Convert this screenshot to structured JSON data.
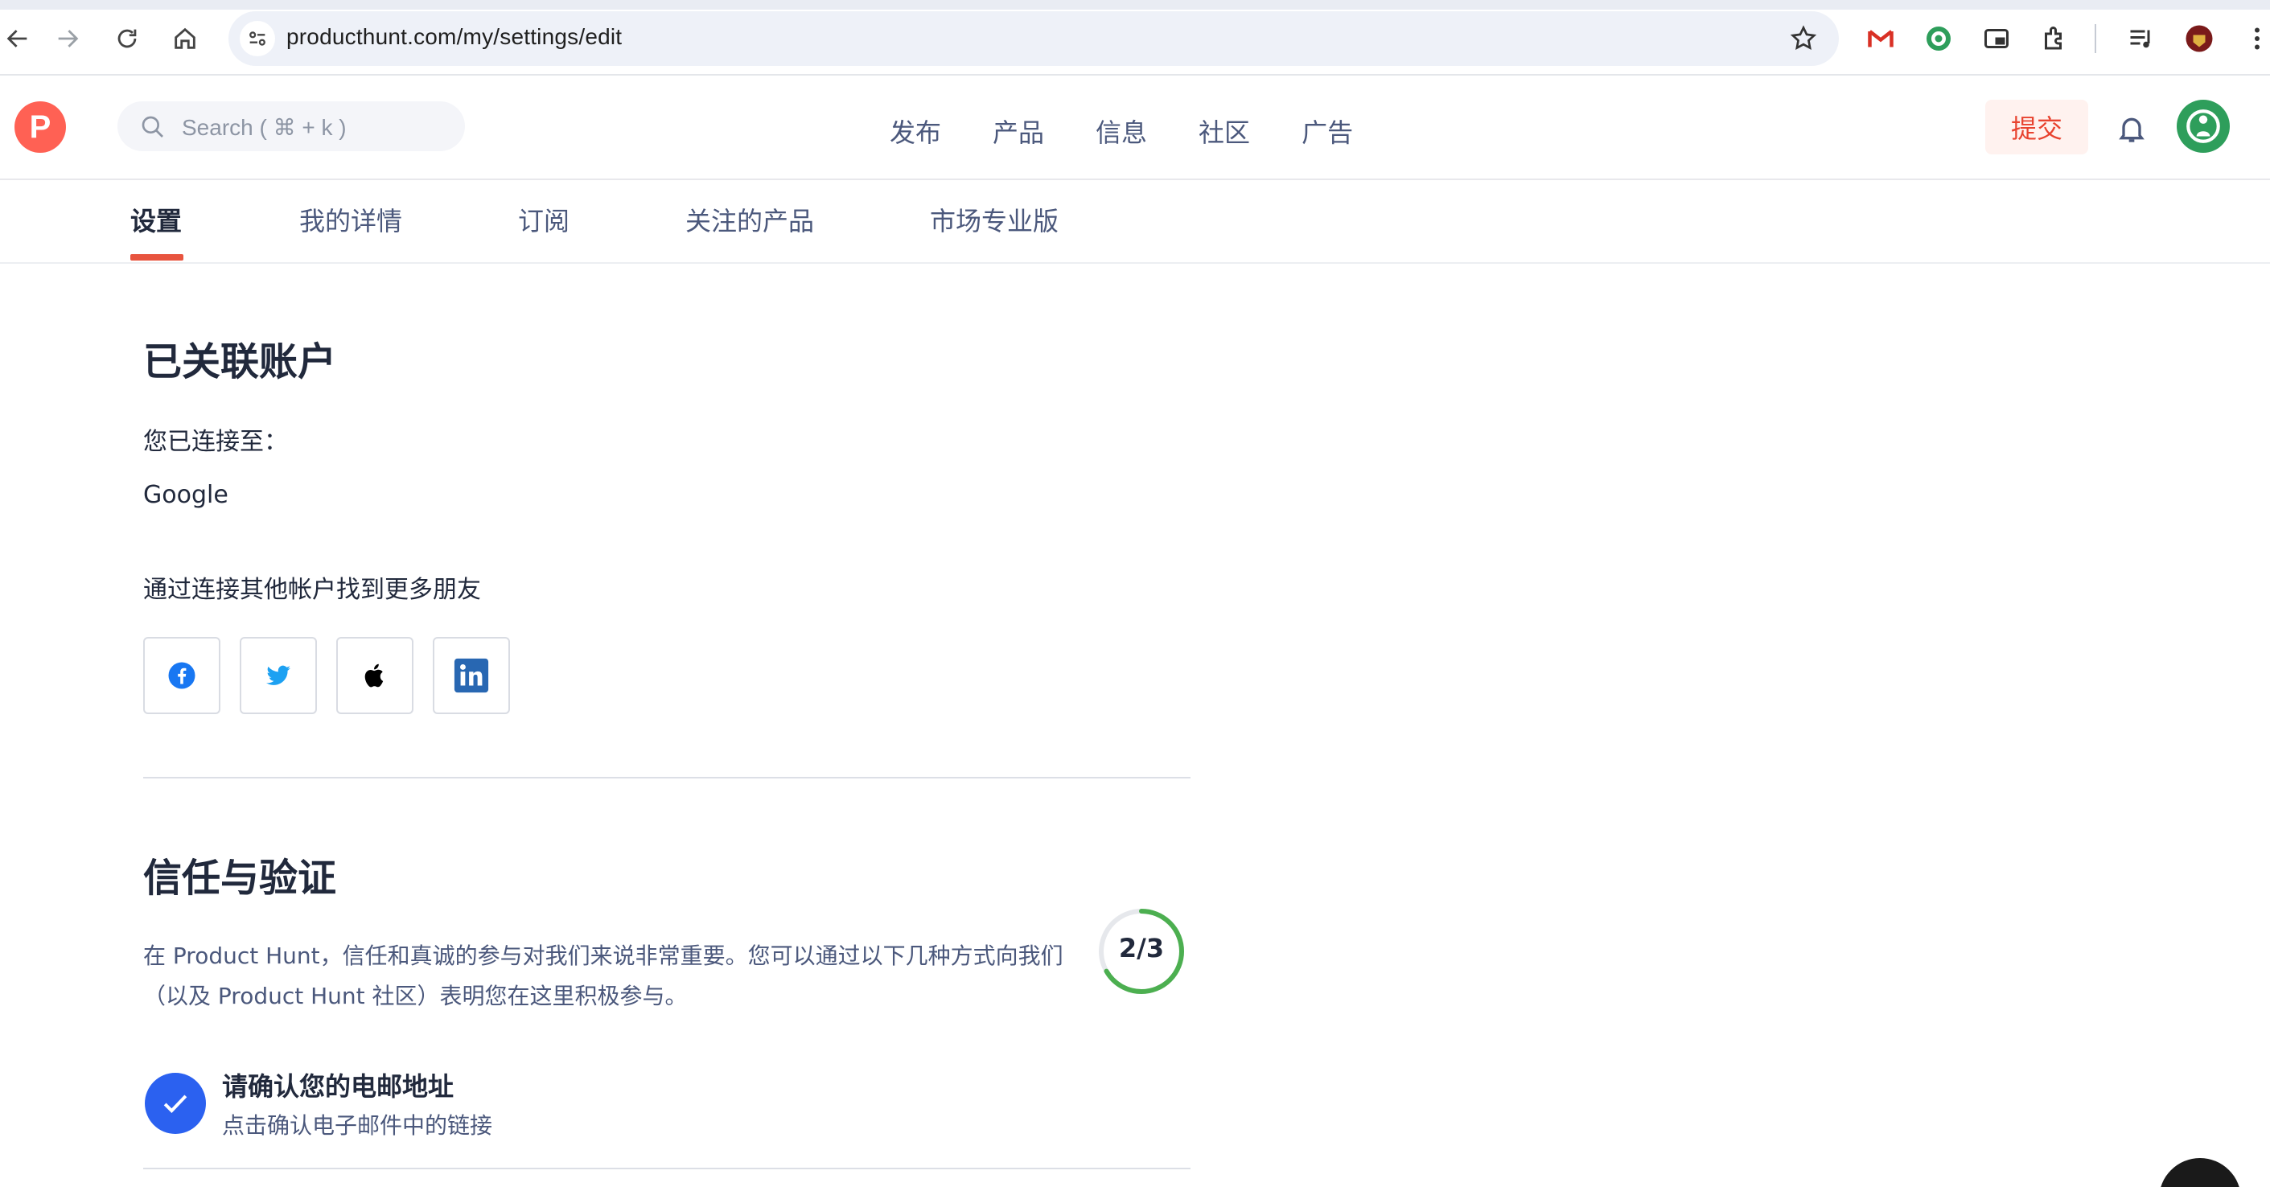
{
  "browser": {
    "url": "producthunt.com/my/settings/edit"
  },
  "header": {
    "logo_letter": "P",
    "search_placeholder": "Search ( ⌘ + k )",
    "nav": [
      "发布",
      "产品",
      "信息",
      "社区",
      "广告"
    ],
    "submit_label": "提交"
  },
  "tabs": [
    "设置",
    "我的详情",
    "订阅",
    "关注的产品",
    "市场专业版"
  ],
  "linked_accounts": {
    "title": "已关联账户",
    "connected_to_label": "您已连接至：",
    "connected": "Google",
    "find_friends": "通过连接其他帐户找到更多朋友",
    "providers": [
      "facebook-icon",
      "twitter-icon",
      "apple-icon",
      "linkedin-icon"
    ]
  },
  "trust": {
    "title": "信任与验证",
    "description_line1": "在 Product Hunt，信任和真诚的参与对我们来说非常重要。您可以通过以下几种方式向我们",
    "description_line2": "（以及 Product Hunt 社区）表明您在这里积极参与。",
    "progress": "2/3",
    "progress_fraction": 0.6667,
    "items": [
      {
        "title": "请确认您的电邮地址",
        "subtitle": "点击确认电子邮件中的链接",
        "done": true
      }
    ]
  },
  "colors": {
    "brand": "#ff6154",
    "accent_blue": "#2b61f0",
    "progress_green": "#4caf50",
    "tab_underline": "#e8543f"
  }
}
